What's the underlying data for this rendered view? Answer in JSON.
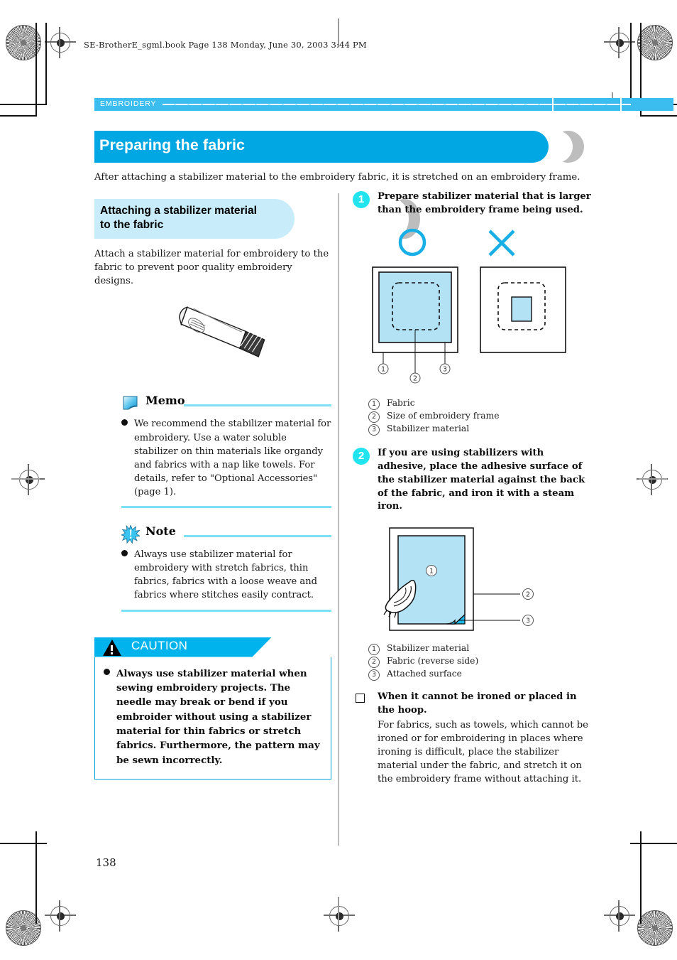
{
  "print_header": "SE-BrotherE_sgml.book  Page 138  Monday, June 30, 2003  3:44 PM",
  "running_head": {
    "chapter": "EMBROIDERY"
  },
  "title": {
    "text": "Preparing the fabric"
  },
  "lead": "After attaching a stabilizer material to the embroidery fabric, it is stretched on an embroidery frame.",
  "left_column": {
    "section_heading": "Attaching a stabilizer material to the fabric",
    "section_heading_line1": "Attaching a stabilizer material",
    "section_heading_line2": "to the fabric",
    "intro": "Attach a stabilizer material for embroidery to the fabric to prevent poor quality embroidery designs.",
    "figure_glue_tube": "adhesive-tube-illustration",
    "memo": {
      "icon": "memo-page-icon",
      "title": "Memo",
      "items": [
        "We recommend the stabilizer material for embroidery. Use a water soluble stabilizer on thin materials like organdy and fabrics with a nap like towels. For details, refer to \"Optional Accessories\" (page 1)."
      ]
    },
    "note": {
      "icon": "note-starburst-icon",
      "title": "Note",
      "items": [
        "Always use stabilizer material for embroidery with stretch fabrics, thin fabrics, fabrics with a loose weave and fabrics where stitches easily contract."
      ]
    },
    "caution": {
      "icon": "warning-triangle-icon",
      "label": "CAUTION",
      "items": [
        "Always use stabilizer material when sewing embroidery projects. The needle may break or bend if you embroider without using a stabilizer material for thin fabrics or stretch fabrics. Furthermore, the pattern may be sewn incorrectly."
      ]
    }
  },
  "right_column": {
    "steps": [
      {
        "number": "1",
        "text": "Prepare stabilizer material that is larger than the embroidery frame being used.",
        "figure": {
          "name": "stabilizer-size-comparison-diagram",
          "good_mark": "O",
          "bad_mark": "X",
          "callouts": [
            "1",
            "2",
            "3"
          ]
        },
        "legend": [
          {
            "num": "1",
            "label": "Fabric"
          },
          {
            "num": "2",
            "label": "Size of embroidery frame"
          },
          {
            "num": "3",
            "label": "Stabilizer material"
          }
        ]
      },
      {
        "number": "2",
        "text": "If you are using stabilizers with adhesive, place the adhesive surface of the stabilizer material against the back of the fabric, and iron it with a steam iron.",
        "figure": {
          "name": "iron-stabilizer-onto-fabric-diagram",
          "callouts": [
            "1",
            "2",
            "3"
          ]
        },
        "legend": [
          {
            "num": "1",
            "label": "Stabilizer material"
          },
          {
            "num": "2",
            "label": "Fabric (reverse side)"
          },
          {
            "num": "3",
            "label": "Attached surface"
          }
        ]
      }
    ],
    "subsection": {
      "bullet": "square-bullet",
      "heading": "When it cannot be ironed or placed in the hoop.",
      "body": "For fabrics, such as towels, which cannot be ironed or for embroidering in places where ironing is difficult, place the stabilizer material under the fabric, and stretch it on the embroidery frame without attaching it."
    }
  },
  "page_number": "138",
  "colors": {
    "accent_blue": "#00a7e3",
    "bar_blue": "#3cbdef",
    "pale_blue": "#c8ecfa",
    "badge_cyan": "#22e4ef",
    "rule_cyan": "#7fdff5",
    "fabric_fill": "#b3e2f5",
    "attached_fill": "#1cb8ec",
    "crescent_gray": "#bdbdbd"
  }
}
